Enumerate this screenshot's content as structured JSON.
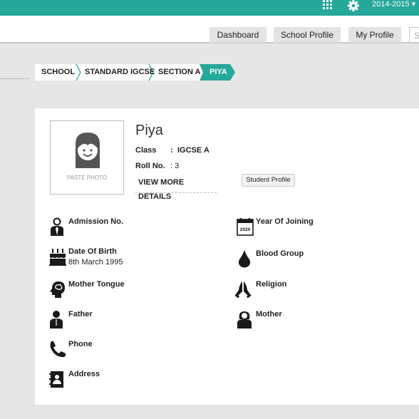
{
  "topbar": {
    "year": "2014-2015 ▾",
    "icons": [
      "apps-grid-icon",
      "gear-icon"
    ]
  },
  "nav": {
    "tabs": [
      "Dashboard",
      "School Profile",
      "My Profile"
    ],
    "search_placeholder": "S"
  },
  "breadcrumb": [
    "SCHOOL",
    "STANDARD IGCSE",
    "SECTION A",
    "PIYA"
  ],
  "colors": {
    "accent": "#25a79a",
    "dark": "#1a1a1a"
  },
  "student": {
    "photo_caption": "PASTE PHOTO",
    "name": "Piya",
    "class_label": "Class",
    "class_sep": ":",
    "class_value": "IGCSE A",
    "roll_label": "Roll No.",
    "roll_value": ": 3",
    "view_more": "VIEW MORE DETAILS",
    "profile_button": "Student Profile"
  },
  "details": {
    "left": [
      {
        "label": "Admission No.",
        "value": "",
        "icon": "admission-icon"
      },
      {
        "label": "Date Of Birth",
        "value": "8th March 1995",
        "icon": "birthday-cake-icon"
      },
      {
        "label": "Mother Tongue",
        "value": "",
        "icon": "head-brain-icon"
      },
      {
        "label": "Father",
        "value": "",
        "icon": "father-icon"
      },
      {
        "label": "Phone",
        "value": "",
        "icon": "phone-icon"
      },
      {
        "label": "Address",
        "value": "",
        "icon": "address-book-icon"
      }
    ],
    "right": [
      {
        "label": "Year Of Joining",
        "value": "",
        "icon": "calendar-icon",
        "icon_text": "2020"
      },
      {
        "label": "Blood Group",
        "value": "",
        "icon": "blood-drop-icon"
      },
      {
        "label": "Religion",
        "value": "",
        "icon": "praying-hands-icon"
      },
      {
        "label": "Mother",
        "value": "",
        "icon": "mother-icon"
      }
    ]
  }
}
